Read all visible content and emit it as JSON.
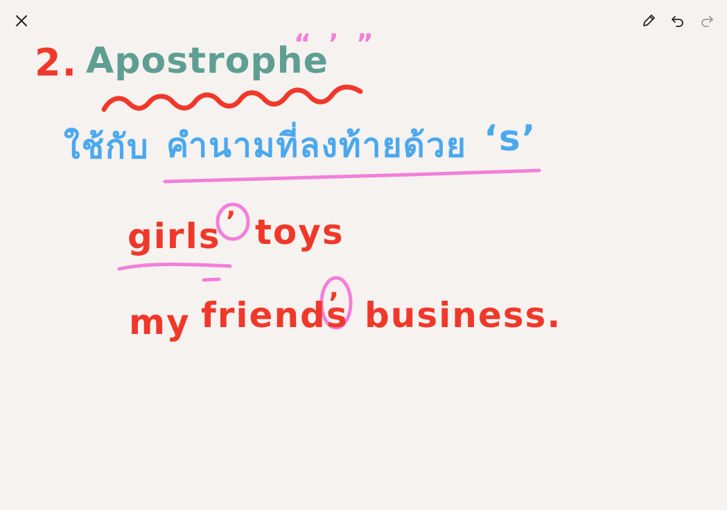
{
  "toolbar": {
    "close_icon": "close-icon",
    "pen_icon": "pencil-icon",
    "undo_icon": "undo-icon",
    "redo_icon": "redo-icon",
    "redo_enabled": false
  },
  "note": {
    "heading_number": "2.",
    "heading_title": "Apostrophe",
    "heading_symbol": "“ ’ ”",
    "thai_prefix": "ใช้กับ",
    "thai_rule": "คำนามที่ลงท้ายด้วย",
    "thai_letter": "‘s’",
    "example1_noun": "girls",
    "example1_mark": "’",
    "example1_rest": "toys",
    "example2_my": "my",
    "example2_noun": "friends",
    "example2_mark": "’",
    "example2_rest": "business."
  },
  "colors": {
    "background": "#f6f2ef",
    "red_ink": "#f0382a",
    "teal_ink": "#5f9e93",
    "pink_ink": "#f27fd9",
    "blue_ink": "#4aa8ee",
    "toolbar_icon": "#222222",
    "toolbar_icon_disabled": "#9a9a9a"
  }
}
